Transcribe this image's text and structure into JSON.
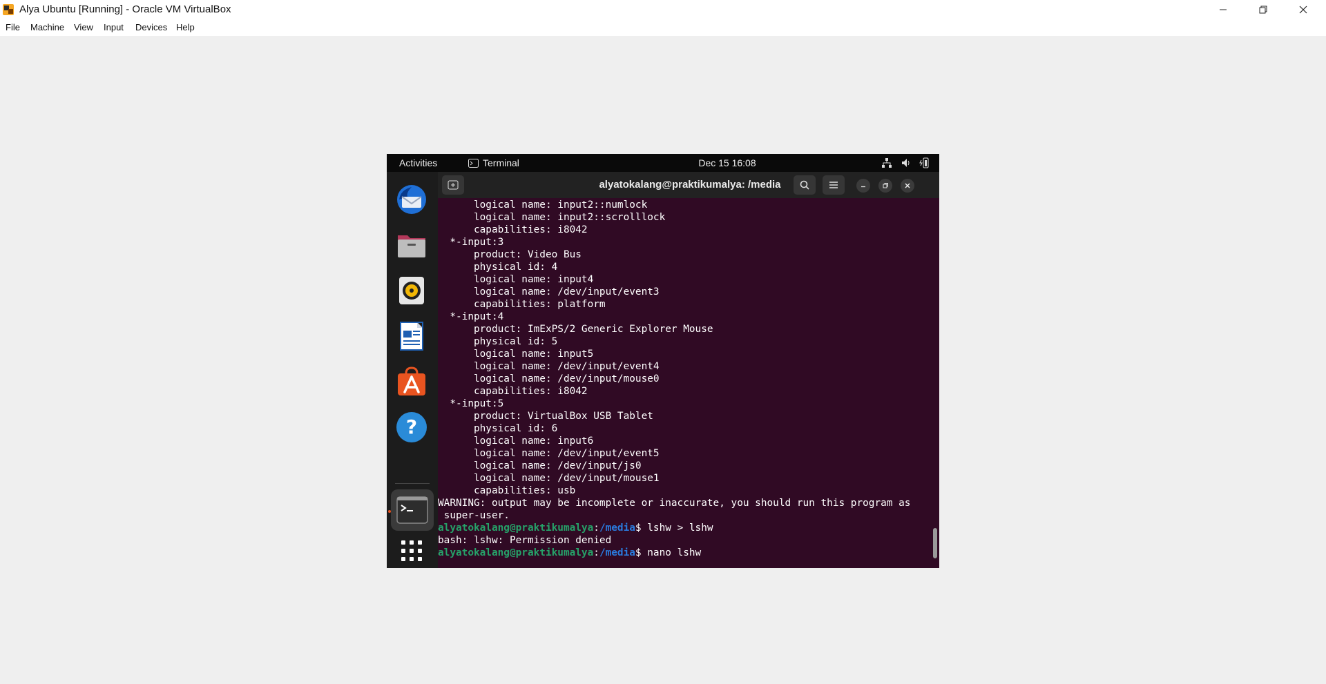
{
  "window": {
    "title": "Alya Ubuntu [Running] - Oracle VM VirtualBox",
    "menu": [
      "File",
      "Machine",
      "View",
      "Input",
      "Devices",
      "Help"
    ]
  },
  "ubuntu": {
    "activities": "Activities",
    "app_name": "Terminal",
    "clock": "Dec 15  16:08",
    "dock": [
      {
        "name": "thunderbird-icon"
      },
      {
        "name": "files-icon"
      },
      {
        "name": "rhythmbox-icon"
      },
      {
        "name": "libreoffice-writer-icon"
      },
      {
        "name": "app-center-icon"
      },
      {
        "name": "help-icon"
      },
      {
        "name": "terminal-icon"
      },
      {
        "name": "show-apps-icon"
      }
    ]
  },
  "terminal": {
    "title": "alyatokalang@praktikumalya: /media",
    "lines": [
      "      logical name: input2::numlock",
      "      logical name: input2::scrolllock",
      "      capabilities: i8042",
      "  *-input:3",
      "      product: Video Bus",
      "      physical id: 4",
      "      logical name: input4",
      "      logical name: /dev/input/event3",
      "      capabilities: platform",
      "  *-input:4",
      "      product: ImExPS/2 Generic Explorer Mouse",
      "      physical id: 5",
      "      logical name: input5",
      "      logical name: /dev/input/event4",
      "      logical name: /dev/input/mouse0",
      "      capabilities: i8042",
      "  *-input:5",
      "      product: VirtualBox USB Tablet",
      "      physical id: 6",
      "      logical name: input6",
      "      logical name: /dev/input/event5",
      "      logical name: /dev/input/js0",
      "      logical name: /dev/input/mouse1",
      "      capabilities: usb",
      "WARNING: output may be incomplete or inaccurate, you should run this program as",
      " super-user."
    ],
    "prompts": [
      {
        "user": "alyatokalang@praktikumalya",
        "sep": ":",
        "path": "/media",
        "sym": "$ ",
        "cmd": "lshw > lshw"
      },
      {
        "output": "bash: lshw: Permission denied"
      },
      {
        "user": "alyatokalang@praktikumalya",
        "sep": ":",
        "path": "/media",
        "sym": "$ ",
        "cmd": "nano lshw"
      }
    ]
  },
  "colors": {
    "terminal_bg": "#300a24",
    "prompt_user": "#26a269",
    "prompt_path": "#2a7bde"
  }
}
